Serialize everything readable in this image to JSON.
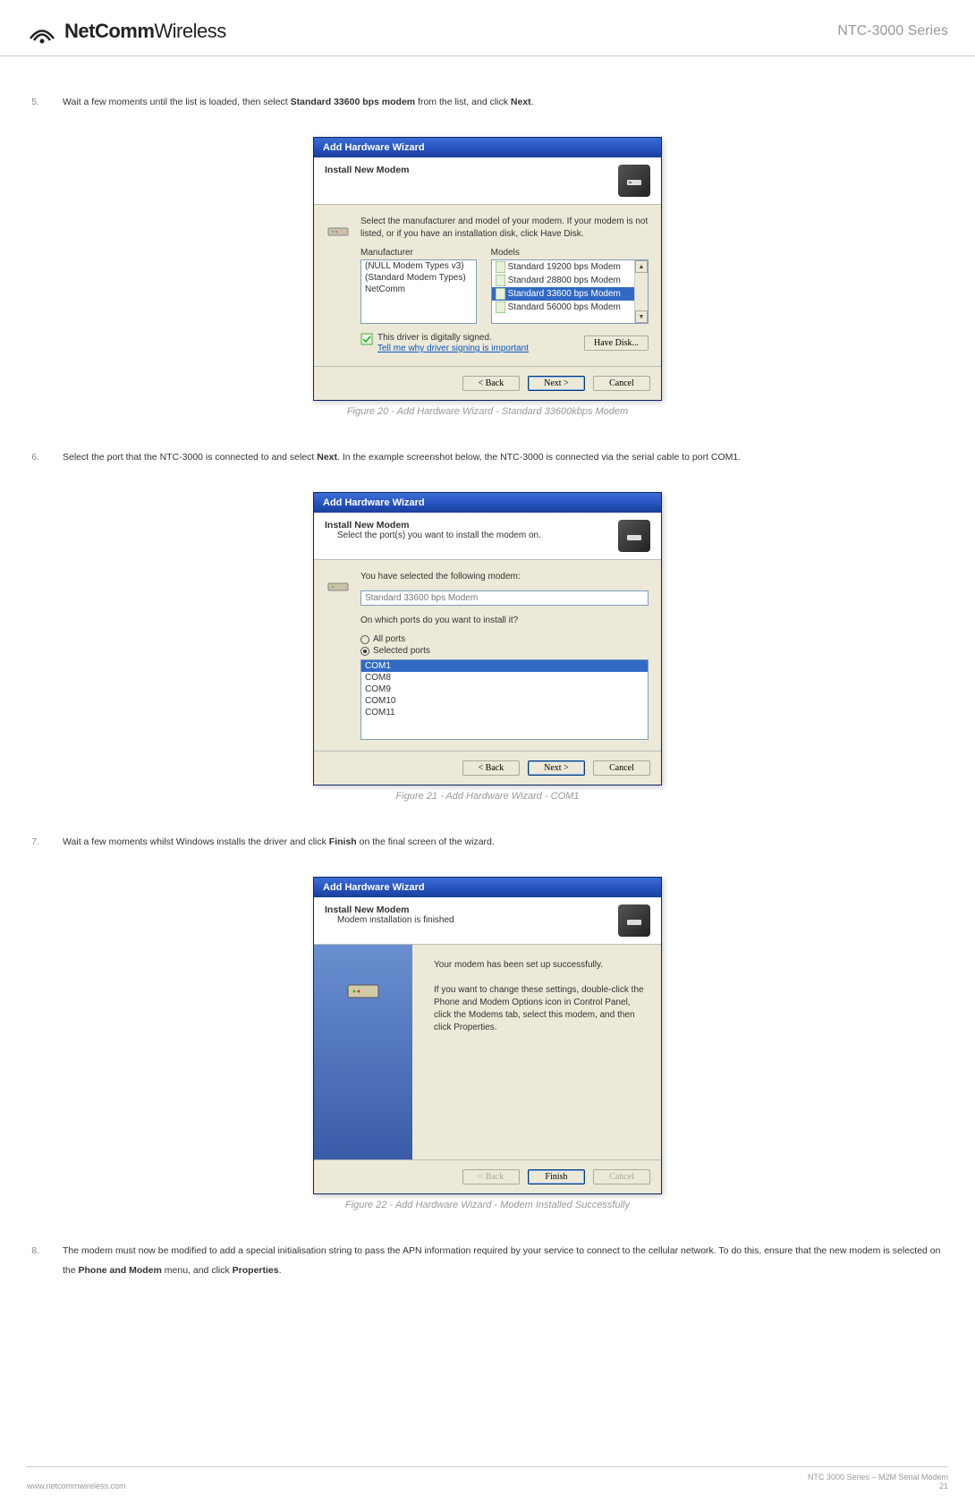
{
  "header": {
    "brand_prefix": "NetComm",
    "brand_suffix": "Wireless",
    "series": "NTC-3000 Series"
  },
  "steps": {
    "s5": {
      "num": "5.",
      "t1": "Wait a few moments until the list is loaded, then select ",
      "b1": "Standard 33600 bps modem",
      "t2": " from the list, and click ",
      "b2": "Next",
      "t3": "."
    },
    "s6": {
      "num": "6.",
      "t1": "Select the port that the NTC-3000 is connected to and select ",
      "b1": "Next",
      "t2": ". In the example screenshot below, the NTC-3000 is connected via the serial cable to port COM1."
    },
    "s7": {
      "num": "7.",
      "t1": "Wait a few moments whilst Windows installs the driver and click ",
      "b1": "Finish",
      "t2": " on the final screen of the wizard."
    },
    "s8": {
      "num": "8.",
      "t1": "The modem must now be modified to add a special initialisation string to pass the APN information required by your service to connect to the cellular network. To do this, ensure that the new modem is selected on the ",
      "b1": "Phone  and Modem",
      "t2": " menu, and click ",
      "b2": "Properties",
      "t3": "."
    }
  },
  "captions": {
    "c20": "Figure 20 - Add Hardware Wizard - Standard 33600kbps Modem",
    "c21": "Figure 21 - Add Hardware Wizard - COM1",
    "c22": "Figure 22 - Add Hardware Wizard - Modem Installed Successfully"
  },
  "wizard_common": {
    "title": "Add Hardware Wizard",
    "head_title": "Install New Modem",
    "back": "< Back",
    "next": "Next >",
    "cancel": "Cancel",
    "finish": "Finish"
  },
  "wiz1": {
    "instruction": "Select the manufacturer and model of your modem. If your modem is not listed, or if you have an installation disk, click Have Disk.",
    "manufacturer_label": "Manufacturer",
    "models_label": "Models",
    "manufacturers": [
      "(NULL Modem Types v3)",
      "(Standard Modem Types)",
      "NetComm"
    ],
    "models": [
      "Standard 19200 bps Modem",
      "Standard 28800 bps Modem",
      "Standard 33600 bps Modem",
      "Standard 56000 bps Modem"
    ],
    "signed": "This driver is digitally signed.",
    "why_link": "Tell me why driver signing is important",
    "have_disk": "Have Disk..."
  },
  "wiz2": {
    "subtitle": "Select the port(s) you want to install the modem on.",
    "selected_text": "You have selected the following modem:",
    "selected_modem": "Standard 33600 bps Modem",
    "which_ports": "On which ports do you want to install it?",
    "all_ports": "All ports",
    "selected_ports": "Selected ports",
    "ports": [
      "COM1",
      "COM8",
      "COM9",
      "COM10",
      "COM11"
    ]
  },
  "wiz3": {
    "subtitle": "Modem installation is finished",
    "line1": "Your modem has been set up successfully.",
    "line2": "If you want to change these settings, double-click the Phone and Modem Options icon in Control Panel, click the Modems tab, select this modem, and then click Properties."
  },
  "footer": {
    "url": "www.netcommwireless.com",
    "product": "NTC 3000 Series – M2M Serial Modem",
    "page": "21"
  }
}
